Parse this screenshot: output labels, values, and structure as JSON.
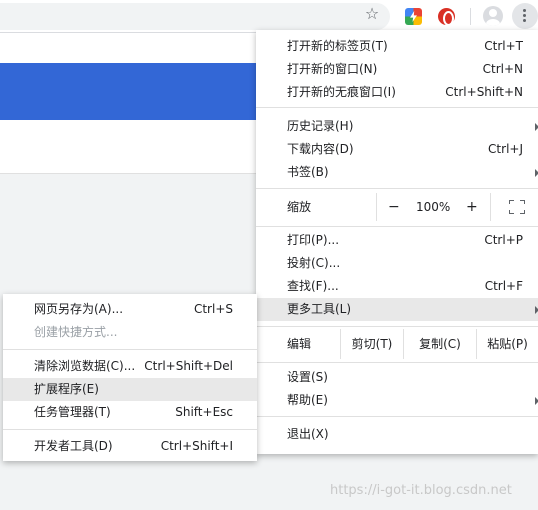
{
  "toolbar": {
    "bookmark_icon": "star-icon",
    "extensions": [
      "colorful-extension-icon",
      "red-extension-icon"
    ],
    "profile_icon": "avatar-icon",
    "menu_icon": "kebab-menu-icon"
  },
  "main_menu": {
    "items": [
      {
        "label": "打开新的标签页(T)",
        "shortcut": "Ctrl+T"
      },
      {
        "label": "打开新的窗口(N)",
        "shortcut": "Ctrl+N"
      },
      {
        "label": "打开新的无痕窗口(I)",
        "shortcut": "Ctrl+Shift+N"
      },
      {
        "label": "历史记录(H)",
        "shortcut": ""
      },
      {
        "label": "下载内容(D)",
        "shortcut": "Ctrl+J"
      },
      {
        "label": "书签(B)",
        "shortcut": ""
      },
      {
        "label": "打印(P)...",
        "shortcut": "Ctrl+P"
      },
      {
        "label": "投射(C)...",
        "shortcut": ""
      },
      {
        "label": "查找(F)...",
        "shortcut": "Ctrl+F"
      },
      {
        "label": "更多工具(L)",
        "shortcut": ""
      },
      {
        "label": "设置(S)",
        "shortcut": ""
      },
      {
        "label": "帮助(E)",
        "shortcut": ""
      },
      {
        "label": "退出(X)",
        "shortcut": ""
      }
    ],
    "zoom": {
      "label": "缩放",
      "minus": "−",
      "value": "100%",
      "plus": "+"
    },
    "edit": {
      "label": "编辑",
      "cut": "剪切(T)",
      "copy": "复制(C)",
      "paste": "粘贴(P)"
    }
  },
  "more_tools_menu": {
    "items": [
      {
        "label": "网页另存为(A)...",
        "shortcut": "Ctrl+S"
      },
      {
        "label": "创建快捷方式...",
        "shortcut": ""
      },
      {
        "label": "清除浏览数据(C)...",
        "shortcut": "Ctrl+Shift+Del"
      },
      {
        "label": "扩展程序(E)",
        "shortcut": ""
      },
      {
        "label": "任务管理器(T)",
        "shortcut": "Shift+Esc"
      },
      {
        "label": "开发者工具(D)",
        "shortcut": "Ctrl+Shift+I"
      }
    ]
  },
  "watermark": "https://i-got-it.blog.csdn.net",
  "colors": {
    "accent": "#3367d6",
    "highlight": "#e8e8e8"
  }
}
